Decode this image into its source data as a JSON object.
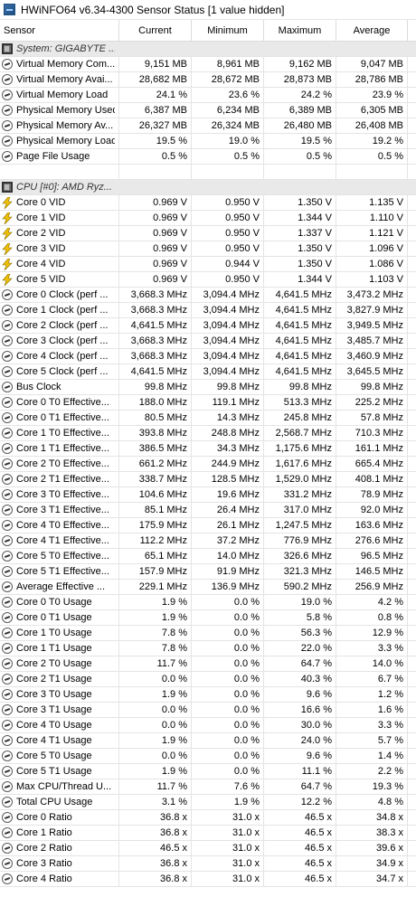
{
  "window": {
    "title": "HWiNFO64 v6.34-4300 Sensor Status [1 value hidden]"
  },
  "columns": [
    "Sensor",
    "Current",
    "Minimum",
    "Maximum",
    "Average"
  ],
  "rows": [
    {
      "kind": "group",
      "icon": "chip-icon",
      "label": "System: GIGABYTE ...",
      "v": [
        "",
        "",
        "",
        ""
      ]
    },
    {
      "kind": "data",
      "icon": "gauge-icon",
      "label": "Virtual Memory Com...",
      "v": [
        "9,151 MB",
        "8,961 MB",
        "9,162 MB",
        "9,047 MB"
      ]
    },
    {
      "kind": "data",
      "icon": "gauge-icon",
      "label": "Virtual Memory Avai...",
      "v": [
        "28,682 MB",
        "28,672 MB",
        "28,873 MB",
        "28,786 MB"
      ]
    },
    {
      "kind": "data",
      "icon": "gauge-icon",
      "label": "Virtual Memory Load",
      "v": [
        "24.1 %",
        "23.6 %",
        "24.2 %",
        "23.9 %"
      ]
    },
    {
      "kind": "data",
      "icon": "gauge-icon",
      "label": "Physical Memory Used",
      "v": [
        "6,387 MB",
        "6,234 MB",
        "6,389 MB",
        "6,305 MB"
      ]
    },
    {
      "kind": "data",
      "icon": "gauge-icon",
      "label": "Physical Memory Av...",
      "v": [
        "26,327 MB",
        "26,324 MB",
        "26,480 MB",
        "26,408 MB"
      ]
    },
    {
      "kind": "data",
      "icon": "gauge-icon",
      "label": "Physical Memory Load",
      "v": [
        "19.5 %",
        "19.0 %",
        "19.5 %",
        "19.2 %"
      ]
    },
    {
      "kind": "data",
      "icon": "gauge-icon",
      "label": "Page File Usage",
      "v": [
        "0.5 %",
        "0.5 %",
        "0.5 %",
        "0.5 %"
      ]
    },
    {
      "kind": "spacer",
      "icon": "",
      "label": "",
      "v": [
        "",
        "",
        "",
        ""
      ]
    },
    {
      "kind": "group",
      "icon": "chip-icon",
      "label": "CPU [#0]: AMD Ryz...",
      "v": [
        "",
        "",
        "",
        ""
      ]
    },
    {
      "kind": "data",
      "icon": "bolt-icon",
      "label": "Core 0 VID",
      "v": [
        "0.969 V",
        "0.950 V",
        "1.350 V",
        "1.135 V"
      ]
    },
    {
      "kind": "data",
      "icon": "bolt-icon",
      "label": "Core 1 VID",
      "v": [
        "0.969 V",
        "0.950 V",
        "1.344 V",
        "1.110 V"
      ]
    },
    {
      "kind": "data",
      "icon": "bolt-icon",
      "label": "Core 2 VID",
      "v": [
        "0.969 V",
        "0.950 V",
        "1.337 V",
        "1.121 V"
      ]
    },
    {
      "kind": "data",
      "icon": "bolt-icon",
      "label": "Core 3 VID",
      "v": [
        "0.969 V",
        "0.950 V",
        "1.350 V",
        "1.096 V"
      ]
    },
    {
      "kind": "data",
      "icon": "bolt-icon",
      "label": "Core 4 VID",
      "v": [
        "0.969 V",
        "0.944 V",
        "1.350 V",
        "1.086 V"
      ]
    },
    {
      "kind": "data",
      "icon": "bolt-icon",
      "label": "Core 5 VID",
      "v": [
        "0.969 V",
        "0.950 V",
        "1.344 V",
        "1.103 V"
      ]
    },
    {
      "kind": "data",
      "icon": "gauge-icon",
      "label": "Core 0 Clock (perf ...",
      "v": [
        "3,668.3 MHz",
        "3,094.4 MHz",
        "4,641.5 MHz",
        "3,473.2 MHz"
      ]
    },
    {
      "kind": "data",
      "icon": "gauge-icon",
      "label": "Core 1 Clock (perf ...",
      "v": [
        "3,668.3 MHz",
        "3,094.4 MHz",
        "4,641.5 MHz",
        "3,827.9 MHz"
      ]
    },
    {
      "kind": "data",
      "icon": "gauge-icon",
      "label": "Core 2 Clock (perf ...",
      "v": [
        "4,641.5 MHz",
        "3,094.4 MHz",
        "4,641.5 MHz",
        "3,949.5 MHz"
      ]
    },
    {
      "kind": "data",
      "icon": "gauge-icon",
      "label": "Core 3 Clock (perf ...",
      "v": [
        "3,668.3 MHz",
        "3,094.4 MHz",
        "4,641.5 MHz",
        "3,485.7 MHz"
      ]
    },
    {
      "kind": "data",
      "icon": "gauge-icon",
      "label": "Core 4 Clock (perf ...",
      "v": [
        "3,668.3 MHz",
        "3,094.4 MHz",
        "4,641.5 MHz",
        "3,460.9 MHz"
      ]
    },
    {
      "kind": "data",
      "icon": "gauge-icon",
      "label": "Core 5 Clock (perf ...",
      "v": [
        "4,641.5 MHz",
        "3,094.4 MHz",
        "4,641.5 MHz",
        "3,645.5 MHz"
      ]
    },
    {
      "kind": "data",
      "icon": "gauge-icon",
      "label": "Bus Clock",
      "v": [
        "99.8 MHz",
        "99.8 MHz",
        "99.8 MHz",
        "99.8 MHz"
      ]
    },
    {
      "kind": "data",
      "icon": "gauge-icon",
      "label": "Core 0 T0 Effective...",
      "v": [
        "188.0 MHz",
        "119.1 MHz",
        "513.3 MHz",
        "225.2 MHz"
      ]
    },
    {
      "kind": "data",
      "icon": "gauge-icon",
      "label": "Core 0 T1 Effective...",
      "v": [
        "80.5 MHz",
        "14.3 MHz",
        "245.8 MHz",
        "57.8 MHz"
      ]
    },
    {
      "kind": "data",
      "icon": "gauge-icon",
      "label": "Core 1 T0 Effective...",
      "v": [
        "393.8 MHz",
        "248.8 MHz",
        "2,568.7 MHz",
        "710.3 MHz"
      ]
    },
    {
      "kind": "data",
      "icon": "gauge-icon",
      "label": "Core 1 T1 Effective...",
      "v": [
        "386.5 MHz",
        "34.3 MHz",
        "1,175.6 MHz",
        "161.1 MHz"
      ]
    },
    {
      "kind": "data",
      "icon": "gauge-icon",
      "label": "Core 2 T0 Effective...",
      "v": [
        "661.2 MHz",
        "244.9 MHz",
        "1,617.6 MHz",
        "665.4 MHz"
      ]
    },
    {
      "kind": "data",
      "icon": "gauge-icon",
      "label": "Core 2 T1 Effective...",
      "v": [
        "338.7 MHz",
        "128.5 MHz",
        "1,529.0 MHz",
        "408.1 MHz"
      ]
    },
    {
      "kind": "data",
      "icon": "gauge-icon",
      "label": "Core 3 T0 Effective...",
      "v": [
        "104.6 MHz",
        "19.6 MHz",
        "331.2 MHz",
        "78.9 MHz"
      ]
    },
    {
      "kind": "data",
      "icon": "gauge-icon",
      "label": "Core 3 T1 Effective...",
      "v": [
        "85.1 MHz",
        "26.4 MHz",
        "317.0 MHz",
        "92.0 MHz"
      ]
    },
    {
      "kind": "data",
      "icon": "gauge-icon",
      "label": "Core 4 T0 Effective...",
      "v": [
        "175.9 MHz",
        "26.1 MHz",
        "1,247.5 MHz",
        "163.6 MHz"
      ]
    },
    {
      "kind": "data",
      "icon": "gauge-icon",
      "label": "Core 4 T1 Effective...",
      "v": [
        "112.2 MHz",
        "37.2 MHz",
        "776.9 MHz",
        "276.6 MHz"
      ]
    },
    {
      "kind": "data",
      "icon": "gauge-icon",
      "label": "Core 5 T0 Effective...",
      "v": [
        "65.1 MHz",
        "14.0 MHz",
        "326.6 MHz",
        "96.5 MHz"
      ]
    },
    {
      "kind": "data",
      "icon": "gauge-icon",
      "label": "Core 5 T1 Effective...",
      "v": [
        "157.9 MHz",
        "91.9 MHz",
        "321.3 MHz",
        "146.5 MHz"
      ]
    },
    {
      "kind": "data",
      "icon": "gauge-icon",
      "label": "Average Effective ...",
      "v": [
        "229.1 MHz",
        "136.9 MHz",
        "590.2 MHz",
        "256.9 MHz"
      ]
    },
    {
      "kind": "data",
      "icon": "gauge-icon",
      "label": "Core 0 T0 Usage",
      "v": [
        "1.9 %",
        "0.0 %",
        "19.0 %",
        "4.2 %"
      ]
    },
    {
      "kind": "data",
      "icon": "gauge-icon",
      "label": "Core 0 T1 Usage",
      "v": [
        "1.9 %",
        "0.0 %",
        "5.8 %",
        "0.8 %"
      ]
    },
    {
      "kind": "data",
      "icon": "gauge-icon",
      "label": "Core 1 T0 Usage",
      "v": [
        "7.8 %",
        "0.0 %",
        "56.3 %",
        "12.9 %"
      ]
    },
    {
      "kind": "data",
      "icon": "gauge-icon",
      "label": "Core 1 T1 Usage",
      "v": [
        "7.8 %",
        "0.0 %",
        "22.0 %",
        "3.3 %"
      ]
    },
    {
      "kind": "data",
      "icon": "gauge-icon",
      "label": "Core 2 T0 Usage",
      "v": [
        "11.7 %",
        "0.0 %",
        "64.7 %",
        "14.0 %"
      ]
    },
    {
      "kind": "data",
      "icon": "gauge-icon",
      "label": "Core 2 T1 Usage",
      "v": [
        "0.0 %",
        "0.0 %",
        "40.3 %",
        "6.7 %"
      ]
    },
    {
      "kind": "data",
      "icon": "gauge-icon",
      "label": "Core 3 T0 Usage",
      "v": [
        "1.9 %",
        "0.0 %",
        "9.6 %",
        "1.2 %"
      ]
    },
    {
      "kind": "data",
      "icon": "gauge-icon",
      "label": "Core 3 T1 Usage",
      "v": [
        "0.0 %",
        "0.0 %",
        "16.6 %",
        "1.6 %"
      ]
    },
    {
      "kind": "data",
      "icon": "gauge-icon",
      "label": "Core 4 T0 Usage",
      "v": [
        "0.0 %",
        "0.0 %",
        "30.0 %",
        "3.3 %"
      ]
    },
    {
      "kind": "data",
      "icon": "gauge-icon",
      "label": "Core 4 T1 Usage",
      "v": [
        "1.9 %",
        "0.0 %",
        "24.0 %",
        "5.7 %"
      ]
    },
    {
      "kind": "data",
      "icon": "gauge-icon",
      "label": "Core 5 T0 Usage",
      "v": [
        "0.0 %",
        "0.0 %",
        "9.6 %",
        "1.4 %"
      ]
    },
    {
      "kind": "data",
      "icon": "gauge-icon",
      "label": "Core 5 T1 Usage",
      "v": [
        "1.9 %",
        "0.0 %",
        "11.1 %",
        "2.2 %"
      ]
    },
    {
      "kind": "data",
      "icon": "gauge-icon",
      "label": "Max CPU/Thread U...",
      "v": [
        "11.7 %",
        "7.6 %",
        "64.7 %",
        "19.3 %"
      ]
    },
    {
      "kind": "data",
      "icon": "gauge-icon",
      "label": "Total CPU Usage",
      "v": [
        "3.1 %",
        "1.9 %",
        "12.2 %",
        "4.8 %"
      ]
    },
    {
      "kind": "data",
      "icon": "gauge-icon",
      "label": "Core 0 Ratio",
      "v": [
        "36.8 x",
        "31.0 x",
        "46.5 x",
        "34.8 x"
      ]
    },
    {
      "kind": "data",
      "icon": "gauge-icon",
      "label": "Core 1 Ratio",
      "v": [
        "36.8 x",
        "31.0 x",
        "46.5 x",
        "38.3 x"
      ]
    },
    {
      "kind": "data",
      "icon": "gauge-icon",
      "label": "Core 2 Ratio",
      "v": [
        "46.5 x",
        "31.0 x",
        "46.5 x",
        "39.6 x"
      ]
    },
    {
      "kind": "data",
      "icon": "gauge-icon",
      "label": "Core 3 Ratio",
      "v": [
        "36.8 x",
        "31.0 x",
        "46.5 x",
        "34.9 x"
      ]
    },
    {
      "kind": "data",
      "icon": "gauge-icon",
      "label": "Core 4 Ratio",
      "v": [
        "36.8 x",
        "31.0 x",
        "46.5 x",
        "34.7 x"
      ]
    }
  ]
}
